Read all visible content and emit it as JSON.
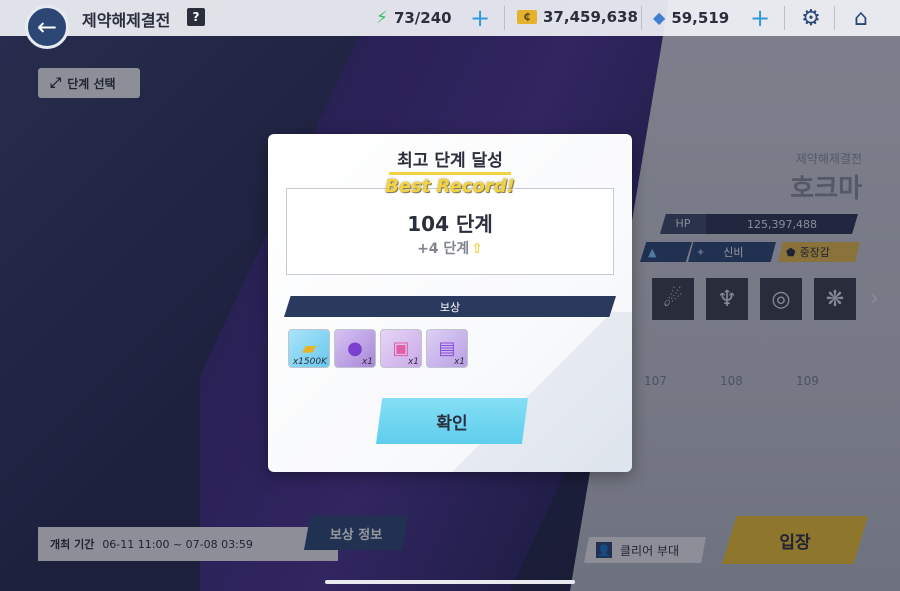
{
  "header": {
    "title": "제약해제결전",
    "help_icon": "?",
    "stamina": "73/240",
    "credits": "37,459,638",
    "gems": "59,519"
  },
  "left": {
    "stage_select_label": "단계 선택"
  },
  "boss": {
    "subtitle": "제약해제결전",
    "name": "호크마",
    "hp_label": "HP",
    "hp_value": "125,397,488",
    "tags": [
      "신비",
      "중장갑"
    ],
    "stage_numbers": [
      "107",
      "108",
      "109"
    ]
  },
  "bottom": {
    "period_label": "개최 기간",
    "period_value": "06-11 11:00 ~ 07-08 03:59",
    "reward_info": "보상 정보",
    "clear_squad": "클리어 부대",
    "enter": "입장"
  },
  "modal": {
    "title": "최고 단계 달성",
    "best_record": "Best Record!",
    "stage": "104 단계",
    "stage_gain": "+4 단계",
    "reward_band": "보상",
    "rewards": [
      {
        "icon": "credit-ticket-icon",
        "count": "x1500K",
        "color": "#6ac8f0"
      },
      {
        "icon": "purple-orb-icon",
        "count": "x1",
        "color": "#a887d9"
      },
      {
        "icon": "pink-box-icon",
        "count": "x1",
        "color": "#c9a8e8"
      },
      {
        "icon": "purple-book-icon",
        "count": "x1",
        "color": "#b99ee4"
      }
    ],
    "confirm": "확인"
  }
}
